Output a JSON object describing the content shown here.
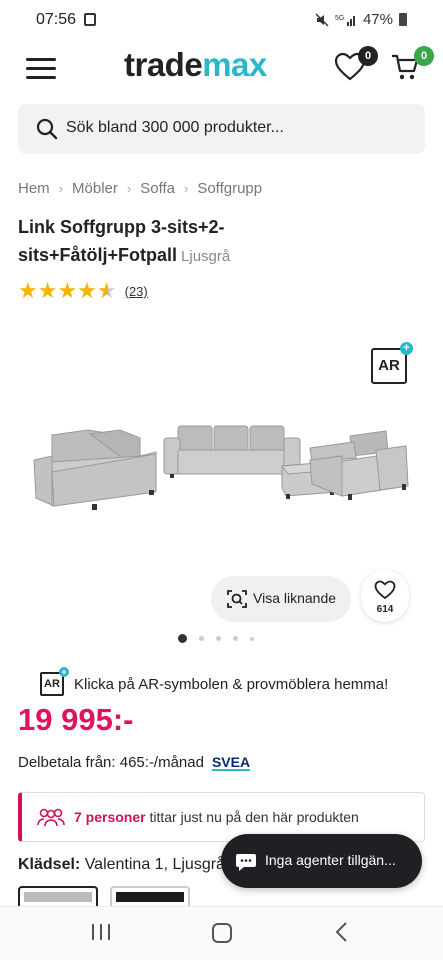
{
  "status_bar": {
    "time": "07:56",
    "battery": "47%"
  },
  "header": {
    "logo_part1": "trade",
    "logo_part2": "max",
    "wishlist_count": "0",
    "cart_count": "0",
    "brand_color": "#2bb7c9"
  },
  "search": {
    "placeholder": "Sök bland 300 000 produkter..."
  },
  "breadcrumb": [
    "Hem",
    "Möbler",
    "Soffa",
    "Soffgrupp"
  ],
  "product": {
    "title": "Link Soffgrupp 3-sits+2-sits+Fåtölj+Fotpall",
    "color_variant": "Ljusgrå",
    "rating": 4.5,
    "review_count": "(23)",
    "ar_label": "AR",
    "image_description": "sofa-set-image"
  },
  "actions": {
    "visa_liknande": "Visa liknande",
    "wishlist_count": "614"
  },
  "carousel": {
    "total_dots": 5,
    "active_index": 0
  },
  "ar_promo": {
    "label": "AR",
    "text": "Klicka på AR-symbolen & provmöblera hemma!"
  },
  "price": {
    "amount": "19 995:-",
    "color": "#e0115f"
  },
  "payment": {
    "text": "Delbetala från: 465:-/månad",
    "provider": "SVEA"
  },
  "viewers": {
    "highlight": "7 personer",
    "rest": " tittar just nu på den här produkten"
  },
  "fabric": {
    "label": "Klädsel:",
    "value": " Valentina 1, Ljusgrå"
  },
  "chat": {
    "text": "Inga agenter tillgän..."
  },
  "nav_bar": {
    "recent_icon": "recent-apps-icon",
    "home_icon": "home-icon",
    "back_icon": "back-icon"
  }
}
